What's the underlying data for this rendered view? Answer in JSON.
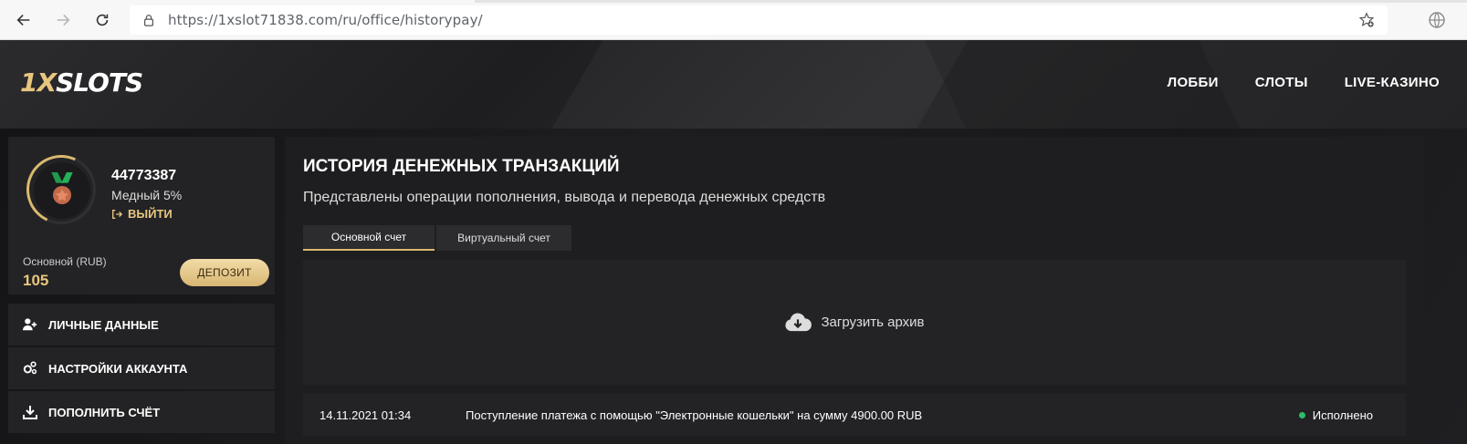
{
  "browser": {
    "url": "https://1xslot71838.com/ru/office/historypay/"
  },
  "header": {
    "logo_left": "1X",
    "logo_right": "SLOTS",
    "nav": [
      "ЛОББИ",
      "СЛОТЫ",
      "LIVE-КАЗИНО"
    ]
  },
  "profile": {
    "user_id": "44773387",
    "level": "Медный 5%",
    "logout_label": "ВЫЙТИ",
    "balance_label": "Основной (RUB)",
    "balance_value": "105",
    "deposit_label": "ДЕПОЗИТ"
  },
  "sidebar": {
    "items": [
      {
        "label": "ЛИЧНЫЕ ДАННЫЕ",
        "icon": "user-add-icon"
      },
      {
        "label": "НАСТРОЙКИ АККАУНТА",
        "icon": "gears-icon"
      },
      {
        "label": "ПОПОЛНИТЬ СЧЁТ",
        "icon": "download-icon"
      }
    ]
  },
  "main": {
    "title": "ИСТОРИЯ ДЕНЕЖНЫХ ТРАНЗАКЦИЙ",
    "subtitle": "Представлены операции пополнения, вывода и перевода денежных средств",
    "tabs": [
      {
        "label": "Основной счет",
        "active": true
      },
      {
        "label": "Виртуальный счет",
        "active": false
      }
    ],
    "archive_label": "Загрузить архив",
    "transactions": [
      {
        "date": "14.11.2021 01:34",
        "description": "Поступление платежа с помощью \"Электронные кошельки\" на сумму 4900.00 RUB",
        "status": "Исполнено"
      }
    ]
  },
  "colors": {
    "accent": "#e8c67f",
    "status_ok": "#2bbf6b"
  }
}
